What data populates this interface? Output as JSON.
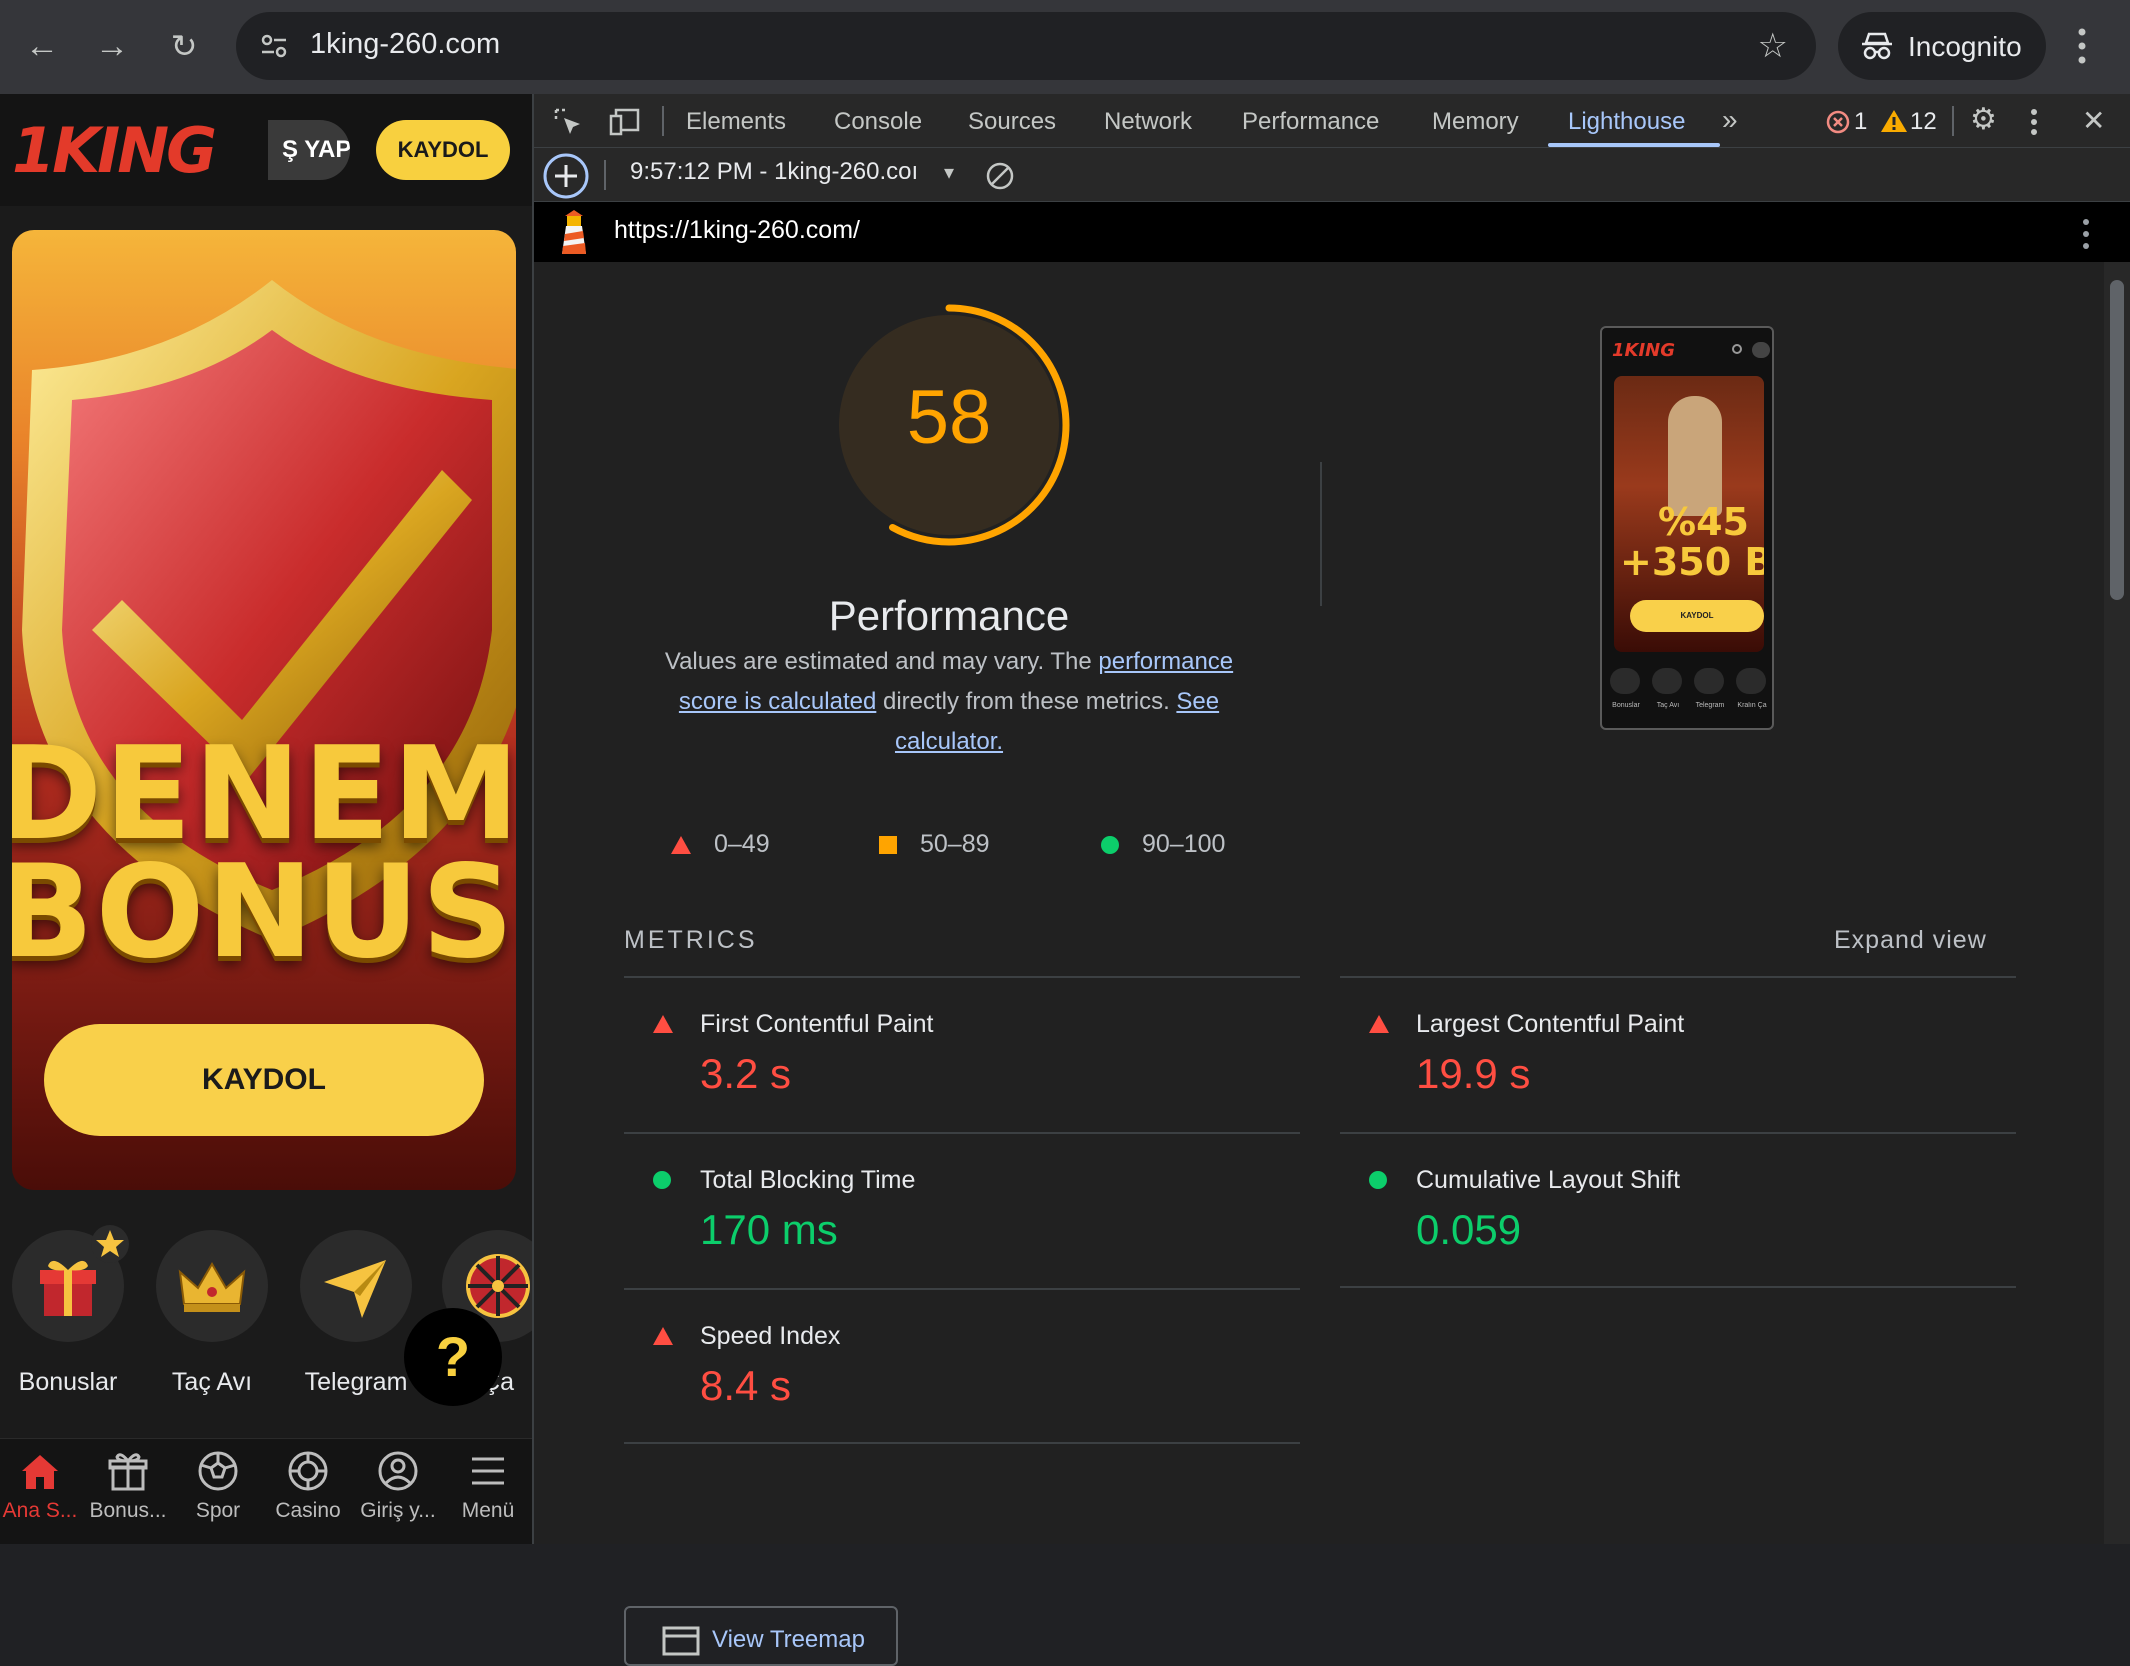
{
  "browser": {
    "url": "1king-260.com",
    "incognito_label": "Incognito"
  },
  "site": {
    "login_label": "Ş YAP",
    "register_label": "KAYDOL",
    "banner_line1": "DENEME",
    "banner_line2": "BONUSU",
    "banner_button": "KAYDOL",
    "quick_items": [
      {
        "label": "Bonuslar"
      },
      {
        "label": "Taç Avı"
      },
      {
        "label": "Telegram"
      },
      {
        "label": "Ça"
      }
    ],
    "help_label": "?",
    "bottom_nav": [
      {
        "label": "Ana S..."
      },
      {
        "label": "Bonus..."
      },
      {
        "label": "Spor"
      },
      {
        "label": "Casino"
      },
      {
        "label": "Giriş y..."
      },
      {
        "label": "Menü"
      }
    ]
  },
  "devtools": {
    "tabs": [
      "Elements",
      "Console",
      "Sources",
      "Network",
      "Performance",
      "Memory",
      "Lighthouse"
    ],
    "active_tab": "Lighthouse",
    "error_count": "1",
    "warning_count": "12",
    "report_select": "9:57:12 PM - 1king-260.coı",
    "report_url": "https://1king-260.com/"
  },
  "lighthouse": {
    "score": "58",
    "score_fraction": 0.58,
    "category": "Performance",
    "desc_pre": "Values are estimated and may vary. The ",
    "desc_link1": "performance score is calculated",
    "desc_mid": " directly from these metrics. ",
    "desc_link2": "See calculator.",
    "legend": [
      "0–49",
      "50–89",
      "90–100"
    ],
    "colors": {
      "fail": "#ff4e42",
      "average": "#ffa400",
      "pass": "#0cce6b"
    },
    "metrics_title": "METRICS",
    "expand_label": "Expand view",
    "metrics": [
      {
        "name": "First Contentful Paint",
        "value": "3.2 s",
        "status": "fail"
      },
      {
        "name": "Largest Contentful Paint",
        "value": "19.9 s",
        "status": "fail"
      },
      {
        "name": "Total Blocking Time",
        "value": "170 ms",
        "status": "pass"
      },
      {
        "name": "Cumulative Layout Shift",
        "value": "0.059",
        "status": "pass"
      },
      {
        "name": "Speed Index",
        "value": "8.4 s",
        "status": "fail"
      }
    ],
    "treemap_label": "View Treemap",
    "thumbnail": {
      "logo": "1KING",
      "promo_line1": "%45",
      "promo_line2": "+350 B",
      "button": "KAYDOL",
      "nav": [
        "Bonuslar",
        "Taç Avı",
        "Telegram",
        "Kralın Ça"
      ]
    }
  }
}
